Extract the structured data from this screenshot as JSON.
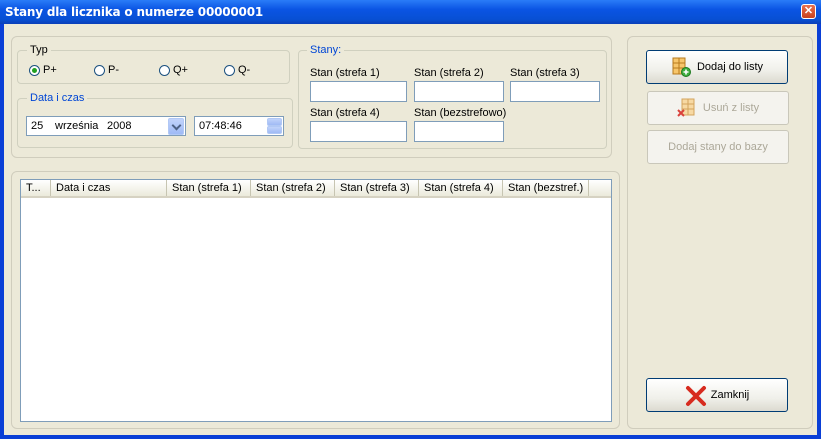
{
  "window": {
    "title": "Stany dla licznika o numerze 00000001",
    "close_glyph": "✕"
  },
  "typ": {
    "legend": "Typ",
    "options": [
      {
        "label": "P+",
        "checked": true
      },
      {
        "label": "P-",
        "checked": false
      },
      {
        "label": "Q+",
        "checked": false
      },
      {
        "label": "Q-",
        "checked": false
      }
    ]
  },
  "datetime": {
    "legend": "Data i czas",
    "date_day": "25",
    "date_month": "września",
    "date_year": "2008",
    "time": "07:48:46"
  },
  "stany": {
    "legend": "Stany:",
    "fields": [
      {
        "label": "Stan (strefa 1)",
        "value": ""
      },
      {
        "label": "Stan (strefa 2)",
        "value": ""
      },
      {
        "label": "Stan (strefa 3)",
        "value": ""
      },
      {
        "label": "Stan (strefa 4)",
        "value": ""
      },
      {
        "label": "Stan (bezstrefowo)",
        "value": ""
      }
    ]
  },
  "list": {
    "columns": [
      "T...",
      "Data i czas",
      "Stan (strefa 1)",
      "Stan (strefa 2)",
      "Stan (strefa 3)",
      "Stan (strefa 4)",
      "Stan (bezstref.)"
    ],
    "rows": []
  },
  "buttons": {
    "add": "Dodaj do listy",
    "remove": "Usuń z listy",
    "add_db": "Dodaj stany do bazy",
    "close": "Zamknij"
  },
  "colors": {
    "title_bar": "#0a54e3",
    "face": "#ece9d8",
    "group_label": "#0046d5"
  }
}
